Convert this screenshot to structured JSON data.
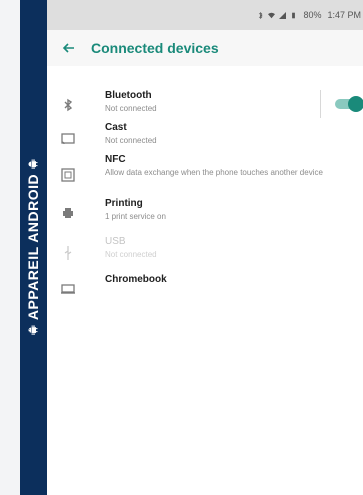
{
  "branding": {
    "vertical_text": "APPAREIL ANDROID"
  },
  "statusbar": {
    "battery": "80%",
    "time": "1:47 PM"
  },
  "appbar": {
    "title": "Connected devices"
  },
  "items": [
    {
      "label": "Bluetooth",
      "sub": "Not connected",
      "icon": "bluetooth-icon"
    },
    {
      "label": "Cast",
      "sub": "Not connected",
      "icon": "cast-icon"
    },
    {
      "label": "NFC",
      "sub": "Allow data exchange when the phone touches another device",
      "icon": "nfc-icon"
    },
    {
      "label": "Printing",
      "sub": "1 print service on",
      "icon": "printer-icon"
    },
    {
      "label": "USB",
      "sub": "Not connected",
      "icon": "usb-icon"
    },
    {
      "label": "Chromebook",
      "sub": "",
      "icon": "laptop-icon"
    }
  ],
  "bluetooth_toggle": {
    "state": "on"
  },
  "colors": {
    "accent": "#1a8a7a",
    "brand_strip": "#0c2f5c"
  }
}
